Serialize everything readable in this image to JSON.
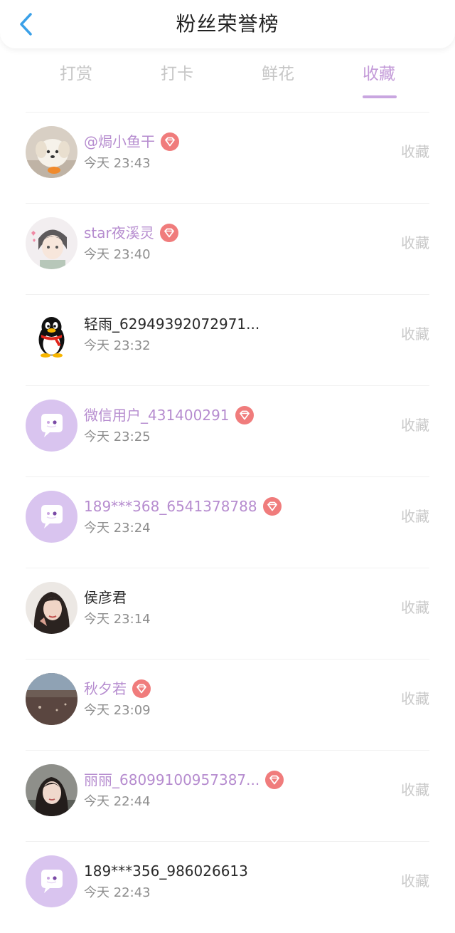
{
  "header": {
    "title": "粉丝荣誉榜"
  },
  "tabs": [
    {
      "label": "打赏"
    },
    {
      "label": "打卡"
    },
    {
      "label": "鲜花"
    },
    {
      "label": "收藏"
    }
  ],
  "active_tab": "收藏",
  "colors": {
    "accent": "#c39ad8",
    "vip_name": "#b68ccf",
    "badge": "#f07c7c",
    "back_arrow": "#3aa0e8"
  },
  "rows": [
    {
      "name": "@焗小鱼干",
      "time": "今天 23:43",
      "action": "收藏",
      "vip": true,
      "avatar": "dog-photo"
    },
    {
      "name": "star夜溪灵",
      "time": "今天 23:40",
      "action": "收藏",
      "vip": true,
      "avatar": "anime-photo"
    },
    {
      "name": "轻雨_62949392072971...",
      "time": "今天 23:32",
      "action": "收藏",
      "vip": false,
      "avatar": "qq-penguin-icon"
    },
    {
      "name": "微信用户_431400291",
      "time": "今天 23:25",
      "action": "收藏",
      "vip": true,
      "avatar": "chat-bubble-icon"
    },
    {
      "name": "189***368_6541378788",
      "time": "今天 23:24",
      "action": "收藏",
      "vip": true,
      "avatar": "chat-bubble-icon"
    },
    {
      "name": "侯彦君",
      "time": "今天 23:14",
      "action": "收藏",
      "vip": false,
      "avatar": "portrait-photo"
    },
    {
      "name": "秋夕若",
      "time": "今天 23:09",
      "action": "收藏",
      "vip": true,
      "avatar": "landscape-photo"
    },
    {
      "name": "丽丽_68099100957387...",
      "time": "今天 22:44",
      "action": "收藏",
      "vip": true,
      "avatar": "portrait-photo"
    },
    {
      "name": "189***356_986026613",
      "time": "今天 22:43",
      "action": "收藏",
      "vip": false,
      "avatar": "chat-bubble-icon"
    }
  ]
}
